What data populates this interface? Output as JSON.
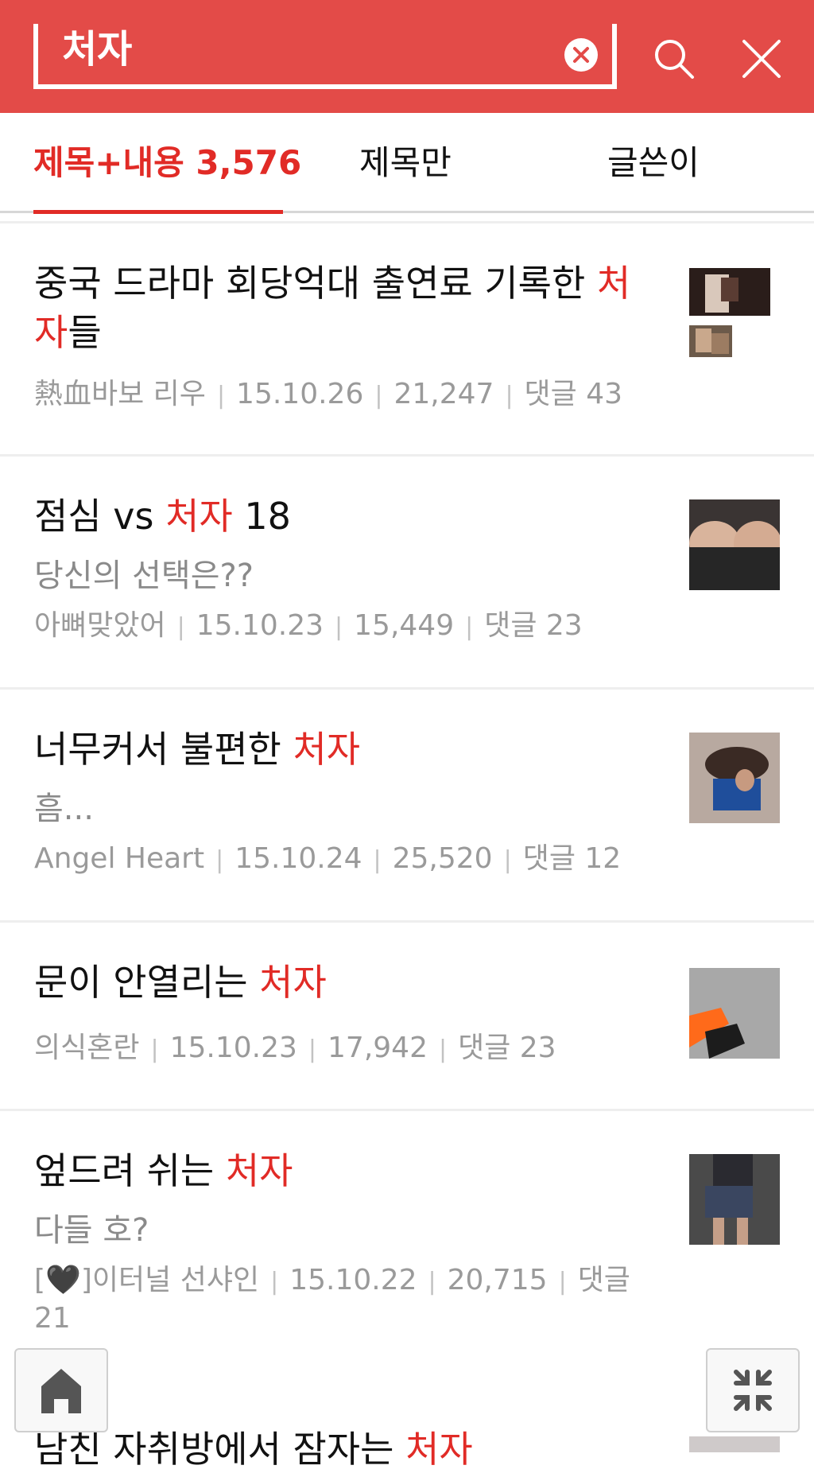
{
  "header": {
    "search_value": "처자",
    "clear_icon": "clear-circle-icon",
    "search_icon": "search-icon",
    "close_icon": "close-icon",
    "accent_color": "#e34b48"
  },
  "tabs": [
    {
      "label": "제목+내용 3,576",
      "active": true
    },
    {
      "label": "제목만",
      "active": false
    },
    {
      "label": "글쓴이",
      "active": false
    }
  ],
  "results": [
    {
      "title_pre": "중국 드라마 회당억대 출연료 기록한 ",
      "title_hl": "처자",
      "title_post": "들",
      "snippet": "",
      "author": "熱血바보 리우",
      "date": "15.10.26",
      "views": "21,247",
      "comments": "댓글 43"
    },
    {
      "title_pre": "점심 vs ",
      "title_hl": "처자",
      "title_post": " 18",
      "snippet": "당신의 선택은??",
      "author": "아뼈맞았어",
      "date": "15.10.23",
      "views": "15,449",
      "comments": "댓글 23"
    },
    {
      "title_pre": "너무커서 불편한 ",
      "title_hl": "처자",
      "title_post": "",
      "snippet": "흠...",
      "author": "Angel Heart",
      "date": "15.10.24",
      "views": "25,520",
      "comments": "댓글 12"
    },
    {
      "title_pre": "문이 안열리는 ",
      "title_hl": "처자",
      "title_post": "",
      "snippet": "",
      "author": "의식혼란",
      "date": "15.10.23",
      "views": "17,942",
      "comments": "댓글 23"
    },
    {
      "title_pre": "엎드려 쉬는 ",
      "title_hl": "처자",
      "title_post": "",
      "snippet": "다들 호?",
      "author": "[🖤]이터널 선샤인",
      "date": "15.10.22",
      "views": "20,715",
      "comments": "댓글 21"
    }
  ],
  "partial_result": {
    "title_pre": "남친 자취방에서 잠자는 ",
    "title_hl": "처자"
  },
  "floating": {
    "home_icon": "home-icon",
    "collapse_icon": "collapse-icon"
  }
}
